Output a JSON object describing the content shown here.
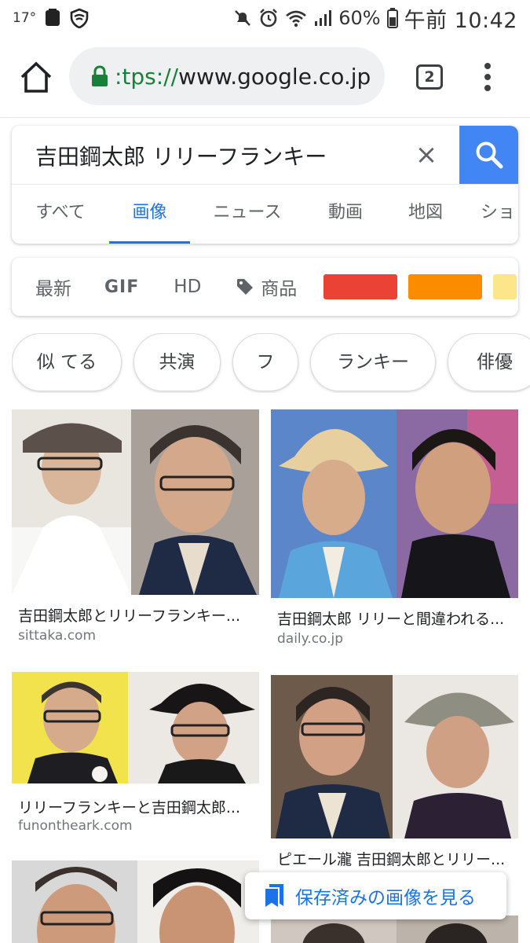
{
  "status_bar": {
    "temperature": "17°",
    "battery_percent": "60%",
    "time": "午前 10:42"
  },
  "browser": {
    "url_scheme": ":tps://",
    "url_host": "www.google.co.jp",
    "tab_count": "2"
  },
  "search": {
    "query": "吉田鋼太郎 リリーフランキー",
    "clear_icon": "×",
    "tabs": [
      {
        "label": "すべて",
        "active": false
      },
      {
        "label": "画像",
        "active": true
      },
      {
        "label": "ニュース",
        "active": false
      },
      {
        "label": "動画",
        "active": false
      },
      {
        "label": "地図",
        "active": false
      },
      {
        "label": "ショ",
        "active": false
      }
    ]
  },
  "filters": {
    "latest": "最新",
    "gif": "GIF",
    "hd": "HD",
    "products": "商品",
    "color_swatches": [
      "#ea4335",
      "#fb8c00",
      "#fde68a"
    ]
  },
  "chips": [
    "似 てる",
    "共演",
    "フ",
    "ランキー",
    "俳優"
  ],
  "results": [
    {
      "title": "吉田鋼太郎とリリーフランキー...",
      "source": "sittaka.com"
    },
    {
      "title": "吉田鋼太郎 リリーと間違われる...",
      "source": "daily.co.jp"
    },
    {
      "title": "リリーフランキーと吉田鋼太郎...",
      "source": "funontheark.com"
    },
    {
      "title": "ピエール瀧 吉田鋼太郎とリリー...",
      "source": ""
    }
  ],
  "saved_images_button": "保存済みの画像を見る"
}
